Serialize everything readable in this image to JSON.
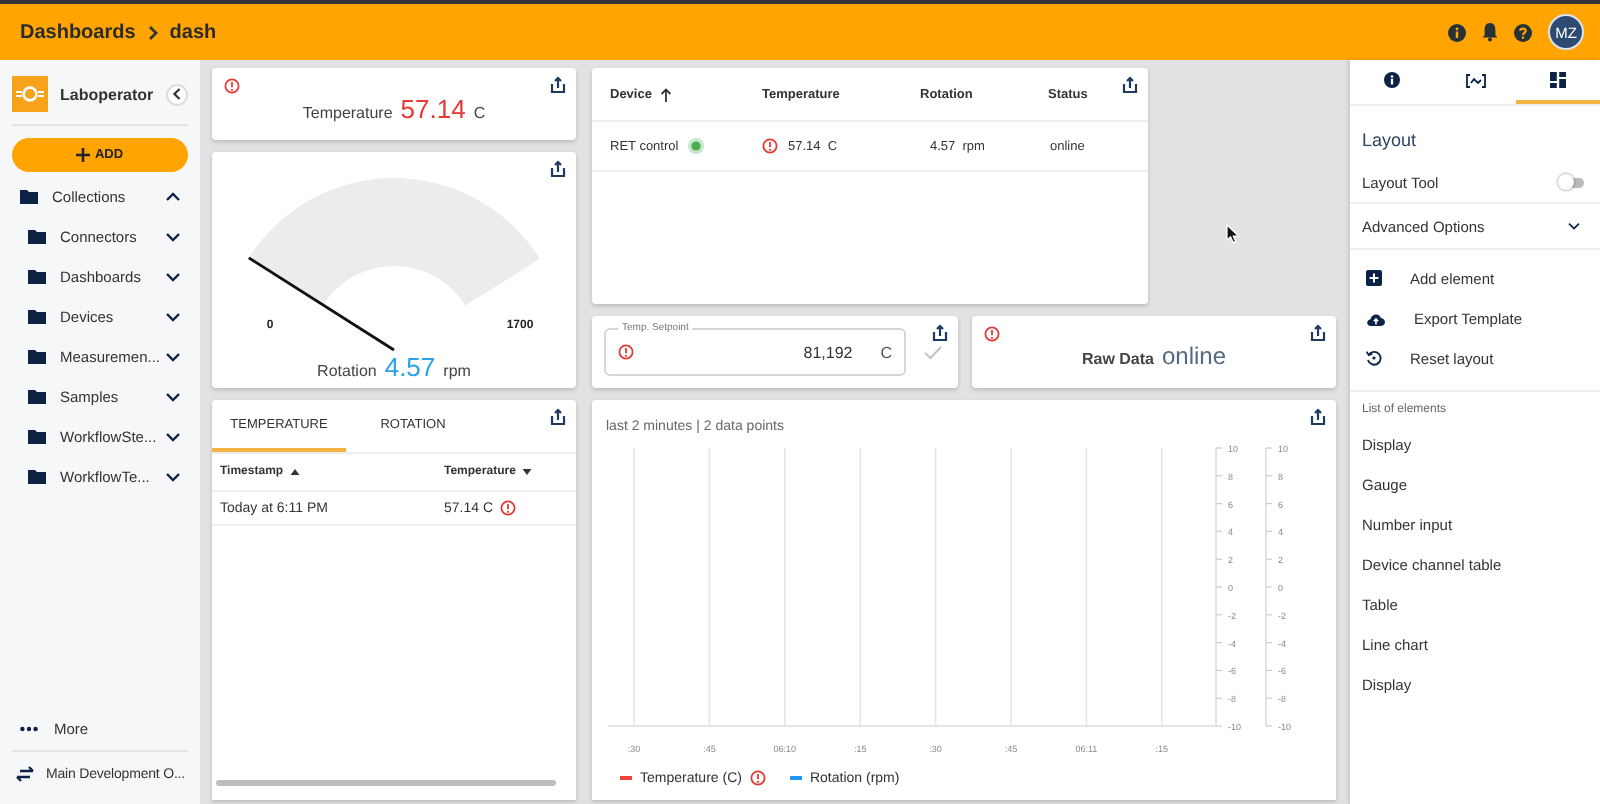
{
  "breadcrumb": [
    {
      "label": "Dashboards"
    },
    {
      "label": "dash"
    }
  ],
  "header": {
    "avatar_initials": "MZ"
  },
  "sidebar": {
    "app_name": "Laboperator",
    "add_button": "ADD",
    "tree": [
      {
        "label": "Collections",
        "expanded": true,
        "children": [
          {
            "label": "Connectors",
            "expanded": false
          },
          {
            "label": "Dashboards",
            "expanded": false
          },
          {
            "label": "Devices",
            "expanded": false
          },
          {
            "label": "Measuremen...",
            "expanded": false
          },
          {
            "label": "Samples",
            "expanded": false
          },
          {
            "label": "WorkflowSte...",
            "expanded": false
          },
          {
            "label": "WorkflowTe...",
            "expanded": false
          }
        ]
      }
    ],
    "footer": [
      {
        "kind": "more",
        "label": "More"
      },
      {
        "kind": "organization",
        "label": "Main Development O..."
      }
    ]
  },
  "temperature_display": {
    "label": "Temperature",
    "value": "57.14",
    "unit": "C",
    "alert": true
  },
  "gauge": {
    "min": "0",
    "max": "1700",
    "label": "Rotation",
    "value": "4.57",
    "unit": "rpm"
  },
  "device_table": {
    "columns": [
      {
        "label": "Device",
        "sorted": true
      },
      {
        "label": "Temperature",
        "sorted": false
      },
      {
        "label": "Rotation",
        "sorted": false
      },
      {
        "label": "Status",
        "sorted": false
      }
    ],
    "rows": [
      {
        "device": "RET control",
        "connected": true,
        "temperature": "57.14",
        "temperature_unit": "C",
        "temperature_alert": true,
        "rotation": "4.57",
        "rotation_unit": "rpm",
        "status": "online"
      }
    ]
  },
  "setpoint": {
    "label": "Temp. Setpoint",
    "value": "81,192",
    "unit": "C",
    "alert": true,
    "submit_disabled": true
  },
  "raw_data": {
    "label": "Raw Data",
    "value": "online",
    "alert": true
  },
  "history_table": {
    "tabs": [
      {
        "label": "TEMPERATURE",
        "selected": true
      },
      {
        "label": "ROTATION",
        "selected": false
      }
    ],
    "columns": [
      {
        "label": "Timestamp",
        "sorted": true,
        "descending": false
      },
      {
        "label": "Temperature",
        "sorted": true,
        "descending": true
      }
    ],
    "rows": [
      {
        "timestamp": "Today at 6:11 PM",
        "value": "57.14 C",
        "alert": true
      }
    ]
  },
  "line_chart": {
    "subtitle": "last 2 minutes | 2 data points",
    "chart_data": {
      "type": "line",
      "x": [
        ":30",
        ":45",
        "06:10",
        ":15",
        ":30",
        ":45",
        "06:11",
        ":15"
      ],
      "series": [
        {
          "name": "Temperature (C)",
          "color": "#f44336",
          "values": [
            null,
            null,
            null,
            null,
            null,
            null,
            null,
            null
          ]
        },
        {
          "name": "Rotation (rpm)",
          "color": "#2196f3",
          "values": [
            null,
            null,
            null,
            null,
            null,
            null,
            null,
            null
          ]
        }
      ],
      "grid": true,
      "ylim": [
        -10,
        10
      ],
      "yticks": [
        10,
        8,
        6,
        4,
        2,
        0,
        -2,
        -4,
        -6,
        -8,
        -10
      ],
      "y2lim": [
        -10,
        10
      ],
      "y2ticks": [
        10,
        8,
        6,
        4,
        2,
        0,
        -2,
        -4,
        -6,
        -8,
        -10
      ]
    },
    "legend_alerts": [
      {
        "alert": true
      },
      {
        "alert": false
      }
    ]
  },
  "right_panel": {
    "tabs": [
      {
        "kind": "info",
        "selected": false
      },
      {
        "kind": "data",
        "selected": false
      },
      {
        "kind": "layout",
        "selected": true
      }
    ],
    "title": "Layout",
    "layout_tool": {
      "label": "Layout Tool",
      "on": false
    },
    "advanced_options": {
      "label": "Advanced Options",
      "expanded": false
    },
    "actions": [
      {
        "kind": "add",
        "label": "Add element"
      },
      {
        "kind": "export",
        "label": "Export Template"
      },
      {
        "kind": "reset",
        "label": "Reset layout"
      }
    ],
    "elements_heading": "List of elements",
    "elements": [
      {
        "label": "Display"
      },
      {
        "label": "Gauge"
      },
      {
        "label": "Number input"
      },
      {
        "label": "Device channel table"
      },
      {
        "label": "Table"
      },
      {
        "label": "Line chart"
      },
      {
        "label": "Display"
      }
    ]
  }
}
